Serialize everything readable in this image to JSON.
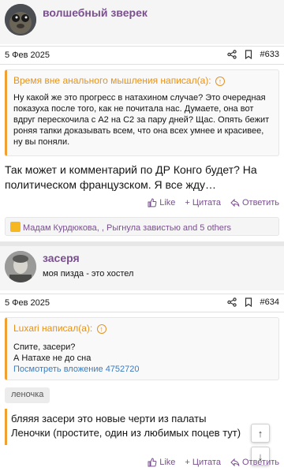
{
  "colors": {
    "accent": "#7a4f8f",
    "quote_border": "#f0a030",
    "link": "#3b7cbf"
  },
  "post1": {
    "username": "волшебный зверек",
    "date": "5 Фев 2025",
    "number": "#633",
    "quote_author": "Время вне анального мышления написал(а):",
    "quote_text": "Ну какой же это прогресс в натахином случае? Это очередная показуха после того, как не почитала нас. Думаете, она вот вдруг перескочила с А2 на С2 за пару дней? Щас. Опять бежит роняя тапки доказывать всем, что она всех умнее и красивее, ну вы поняли.",
    "message": "Так может и комментарий по ДР Конго будет? На политическом французском. Я все жду…",
    "like": "Like",
    "quote_btn": "Цитата",
    "reply": "Ответить",
    "reactions": "Мадам Курдюкова,        , Рыгнула завистью and 5 others"
  },
  "post2": {
    "username": "засеря",
    "user_title": "моя пизда - это хостел",
    "date": "5 Фев 2025",
    "number": "#634",
    "quote_author": "Luxari написал(а):",
    "quote_line1": "Спите, засери?",
    "quote_line2": "А Натахе не до сна",
    "quote_link": "Посмотреть вложение 4752720",
    "tag": "леночка",
    "message": "бляяя засери это новые черти из палаты Леночки (простите, один из любимых поцев тут)",
    "like": "Like",
    "quote_btn": "Цитата",
    "reply": "Ответить"
  },
  "icons": {
    "share": "share-icon",
    "bookmark": "bookmark-icon",
    "like": "thumbs-up-icon",
    "quote": "plus-icon",
    "reply": "reply-icon",
    "up": "arrow-up-icon",
    "down": "arrow-down-icon"
  }
}
